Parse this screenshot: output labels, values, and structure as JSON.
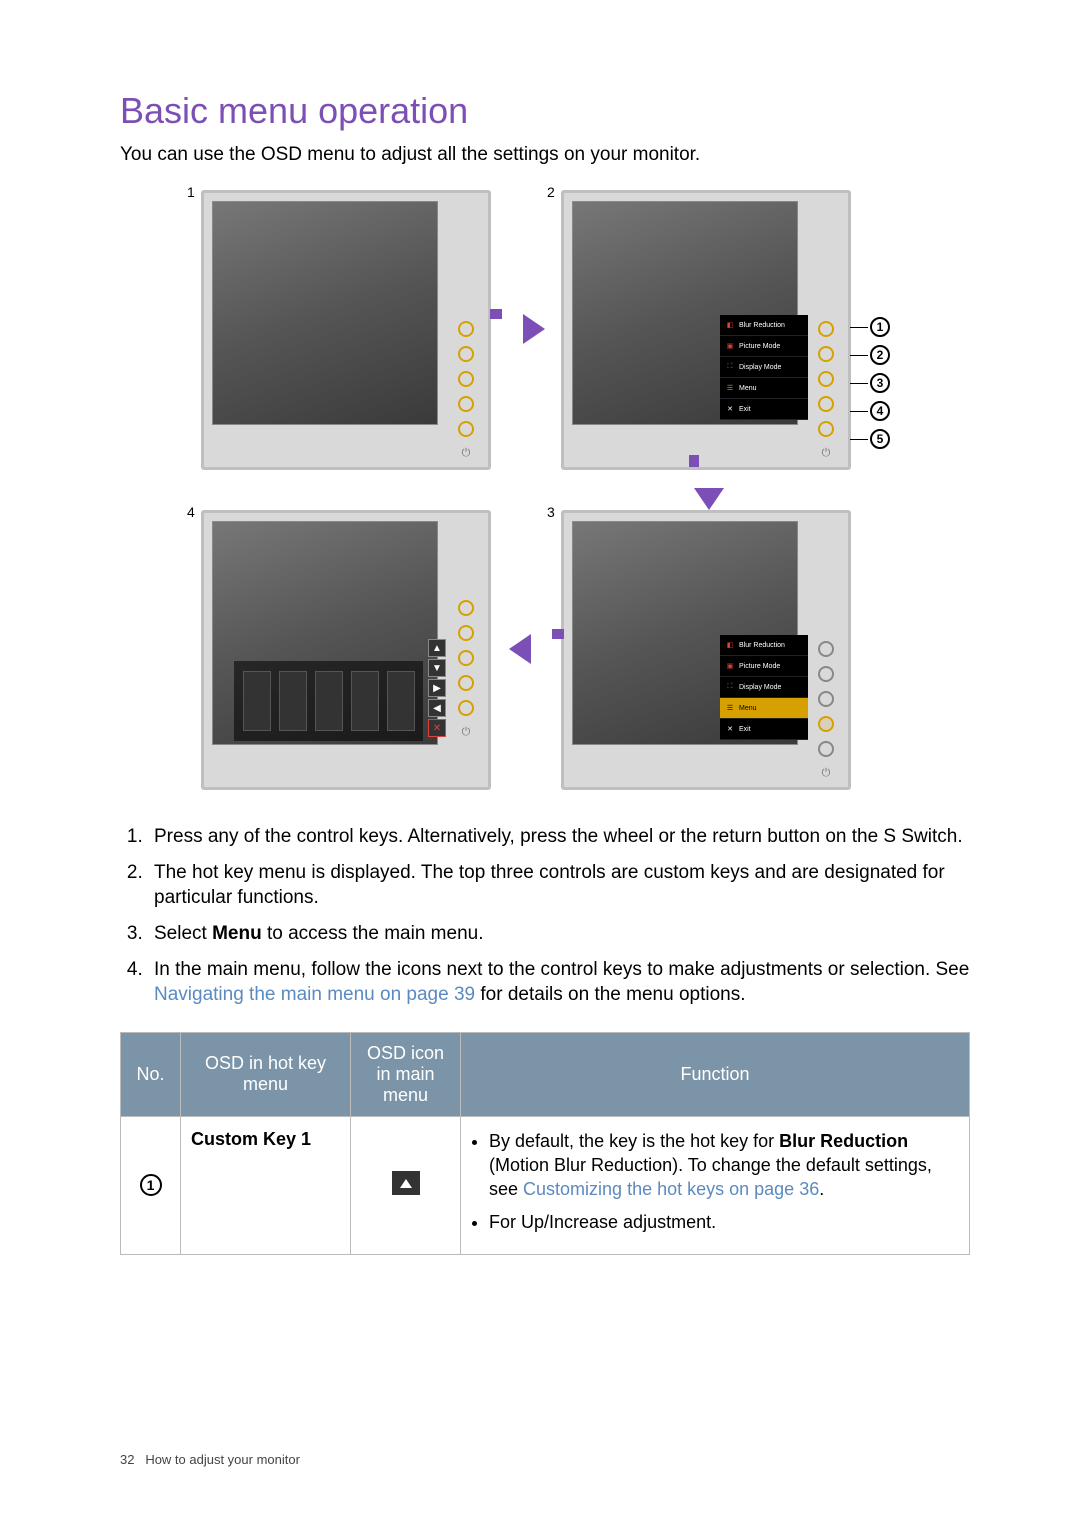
{
  "title": "Basic menu operation",
  "intro": "You can use the OSD menu to adjust all the settings on your monitor.",
  "figure": {
    "step_labels": {
      "s1": "1",
      "s2": "2",
      "s3": "3",
      "s4": "4"
    },
    "callouts": [
      "1",
      "2",
      "3",
      "4",
      "5"
    ],
    "hotkey_menu": {
      "items": [
        {
          "label": "Blur Reduction",
          "icon_color": "red"
        },
        {
          "label": "Picture Mode",
          "icon_color": "red"
        },
        {
          "label": "Display Mode",
          "icon_color": "green"
        },
        {
          "label": "Menu",
          "icon_color": "yellow"
        },
        {
          "label": "Exit",
          "icon_color": "white"
        }
      ]
    }
  },
  "steps": {
    "s1": "Press any of the control keys. Alternatively, press the wheel or the return button on the S Switch.",
    "s2": "The hot key menu is displayed. The top three controls are custom keys and are designated for particular functions.",
    "s3_a": "Select ",
    "s3_b": "Menu",
    "s3_c": " to access the main menu.",
    "s4_a": "In the main menu, follow the icons next to the control keys to make adjustments or selection. See ",
    "s4_link": "Navigating the main menu on page 39",
    "s4_b": " for details on the menu options."
  },
  "table": {
    "headers": {
      "no": "No.",
      "hotkey": "OSD in hot key menu",
      "mainmenu": "OSD icon in main menu",
      "function": "Function"
    },
    "row1": {
      "num": "1",
      "hotkey": "Custom Key 1",
      "func_a": "By default, the key is the hot key for ",
      "func_b": "Blur Reduction",
      "func_c": " (Motion Blur Reduction). To change the default settings, see ",
      "func_link": "Customizing the hot keys on page 36",
      "func_d": ".",
      "func2": "For Up/Increase adjustment."
    }
  },
  "footer": {
    "page": "32",
    "section": "How to adjust your monitor"
  }
}
